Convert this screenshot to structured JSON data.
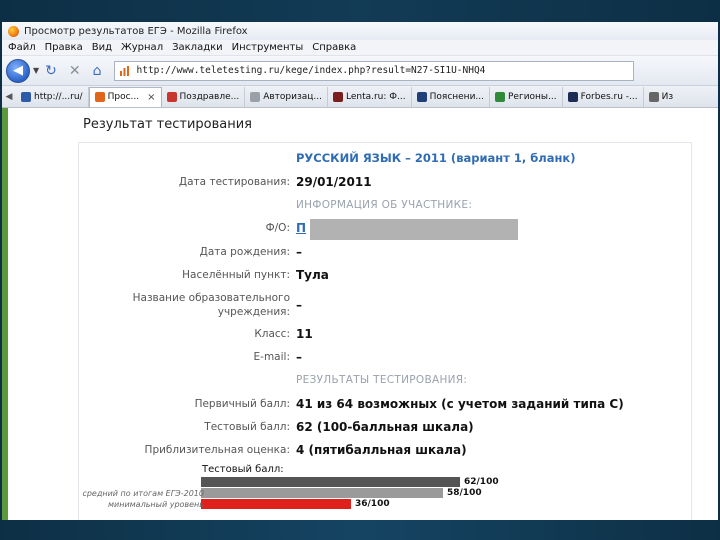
{
  "window": {
    "title": "Просмотр результатов ЕГЭ - Mozilla Firefox"
  },
  "menu": [
    "Файл",
    "Правка",
    "Вид",
    "Журнал",
    "Закладки",
    "Инструменты",
    "Справка"
  ],
  "nav": {
    "url": "http://www.teletesting.ru/kege/index.php?result=N27-SI1U-NHQ4"
  },
  "bookmarks": [
    {
      "label": "http://...ru/",
      "icon_color": "#2a5aa8"
    },
    {
      "label": "Прос...",
      "icon_color": "#e0661c",
      "active": true,
      "close": "×"
    },
    {
      "label": "Поздравле...",
      "icon_color": "#c8372b"
    },
    {
      "label": "Авторизац...",
      "icon_color": "#9aa0a8"
    },
    {
      "label": "Lenta.ru: Ф...",
      "icon_color": "#7a1e1e"
    },
    {
      "label": "Пояснени...",
      "icon_color": "#1e3f7a"
    },
    {
      "label": "Регионы...",
      "icon_color": "#2f8a3a"
    },
    {
      "label": "Forbes.ru -...",
      "icon_color": "#1b2d55"
    },
    {
      "label": "Из",
      "icon_color": "#666666"
    }
  ],
  "page": {
    "heading": "Результат тестирования",
    "subject": "РУССКИЙ ЯЗЫК – 2011 (вариант 1, бланк)",
    "section_participant": "ИНФОРМАЦИЯ ОБ УЧАСТНИКЕ:",
    "section_results": "РЕЗУЛЬТАТЫ ТЕСТИРОВАНИЯ:",
    "rows": {
      "test_date": {
        "label": "Дата тестирования:",
        "value": "29/01/2011"
      },
      "fio": {
        "label": "Ф/О:",
        "value": "П"
      },
      "birth": {
        "label": "Дата рождения:",
        "value": "–"
      },
      "city": {
        "label": "Населённый пункт:",
        "value": "Тула"
      },
      "school_1": {
        "label": "Название образовательного"
      },
      "school_2": {
        "label": "учреждения:",
        "value": "–"
      },
      "grade": {
        "label": "Класс:",
        "value": "11"
      },
      "email": {
        "label": "E-mail:",
        "value": "–"
      },
      "primary": {
        "label": "Первичный балл:",
        "value": "41 из 64 возможных (с учетом заданий типа С)"
      },
      "test_score": {
        "label": "Тестовый балл:",
        "value": "62 (100-балльная шкала)"
      },
      "grade5": {
        "label": "Приблизительная оценка:",
        "value": "4 (пятибалльная шкала)"
      }
    }
  },
  "chart_data": {
    "type": "bar",
    "title": "Тестовый балл:",
    "orientation": "horizontal",
    "xlim": [
      0,
      100
    ],
    "bars": [
      {
        "caption": "",
        "value": 62,
        "label": "62/100",
        "color": "#555555"
      },
      {
        "caption": "средний по итогам ЕГЭ-2010",
        "value": 58,
        "label": "58/100",
        "color": "#9a9a9a"
      },
      {
        "caption": "минимальный уровень",
        "value": 36,
        "label": "36/100",
        "color": "#e0201a"
      }
    ]
  }
}
